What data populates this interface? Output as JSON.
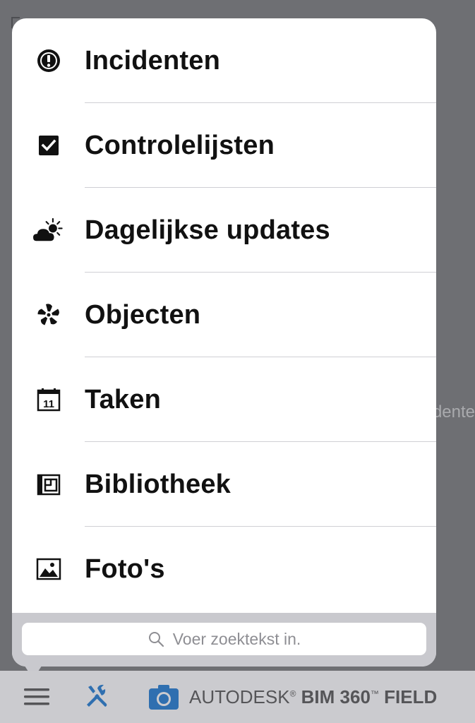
{
  "menu": {
    "items": [
      {
        "label": "Incidenten",
        "icon": "exclamation-circle-icon"
      },
      {
        "label": "Controlelijsten",
        "icon": "checkbox-icon"
      },
      {
        "label": "Dagelijkse updates",
        "icon": "weather-cloud-sun-icon"
      },
      {
        "label": "Objecten",
        "icon": "fan-icon"
      },
      {
        "label": "Taken",
        "icon": "calendar-icon"
      },
      {
        "label": "Bibliotheek",
        "icon": "blueprint-icon"
      },
      {
        "label": "Foto's",
        "icon": "photo-icon"
      }
    ]
  },
  "search": {
    "placeholder": "Voer zoektekst in."
  },
  "background": {
    "partial_text": "dente"
  },
  "toolbar": {
    "brand_autodesk": "AUTODESK",
    "brand_registered": "®",
    "brand_product": "BIM 360",
    "brand_tm": "™",
    "brand_field": "FIELD"
  },
  "colors": {
    "accent_blue": "#2f6fb0",
    "popover_bg": "#ffffff",
    "overlay_bg": "#6e6f73",
    "toolbar_bg": "#cbcbcf"
  }
}
